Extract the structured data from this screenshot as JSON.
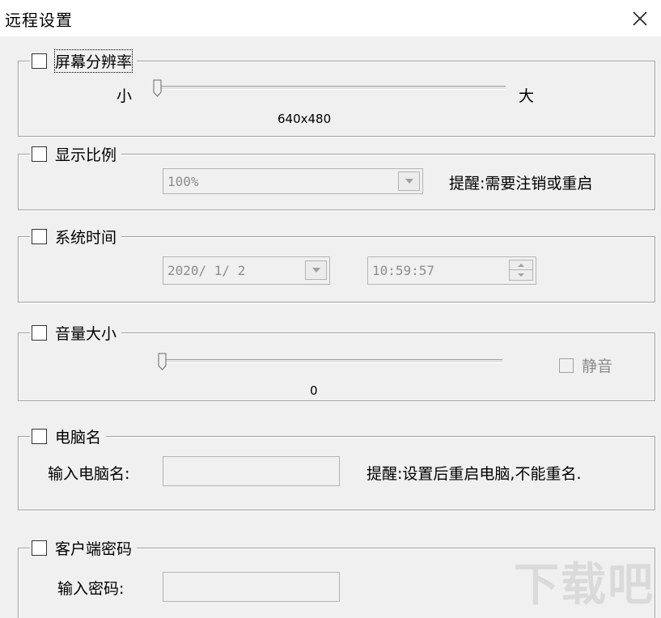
{
  "window": {
    "title": "远程设置"
  },
  "resolution": {
    "label": "屏幕分辨率",
    "min_label": "小",
    "max_label": "大",
    "value": "640x480",
    "slider_fraction": 0.0
  },
  "scale": {
    "label": "显示比例",
    "selected": "100%",
    "hint": "提醒:需要注销或重启"
  },
  "system_time": {
    "label": "系统时间",
    "date": "2020/ 1/ 2",
    "time": "10:59:57"
  },
  "volume": {
    "label": "音量大小",
    "value": "0",
    "slider_fraction": 0.0,
    "mute_label": "静音"
  },
  "computer_name": {
    "label": "电脑名",
    "input_label": "输入电脑名:",
    "input_value": "",
    "hint": "提醒:设置后重启电脑,不能重名."
  },
  "client_password": {
    "label": "客户端密码",
    "input_label": "输入密码:",
    "input_value": ""
  },
  "colors": {
    "background": "#f0f0f0",
    "border": "#a0a0a0",
    "disabled_text": "#8c8c8c"
  },
  "watermark": "下载吧"
}
